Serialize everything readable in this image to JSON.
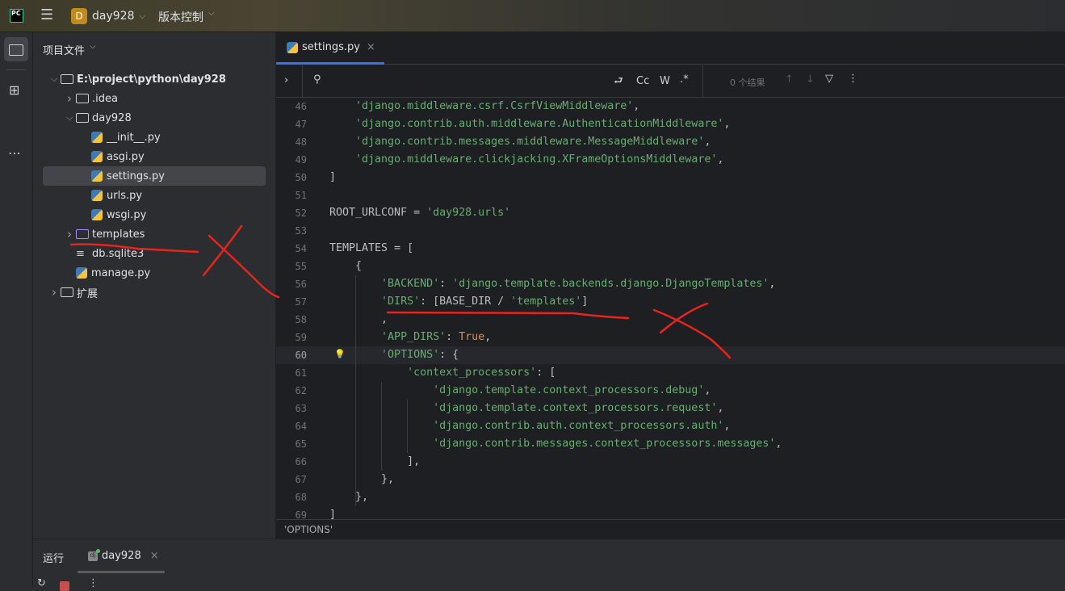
{
  "topbar": {
    "app_logo": "PC",
    "menu_icon": "hamburger-icon",
    "project_badge": "D",
    "project_name": "day928",
    "vcs_label": "版本控制",
    "accent": "#c08a1e"
  },
  "project_panel": {
    "title": "项目文件",
    "items": [
      {
        "label": "E:\\project\\python\\day928",
        "type": "folder",
        "expanded": true
      },
      {
        "label": ".idea",
        "type": "folder",
        "expanded": false
      },
      {
        "label": "day928",
        "type": "package",
        "expanded": true
      },
      {
        "label": "__init__.py",
        "type": "python"
      },
      {
        "label": "asgi.py",
        "type": "python"
      },
      {
        "label": "settings.py",
        "type": "python",
        "selected": true
      },
      {
        "label": "urls.py",
        "type": "python"
      },
      {
        "label": "wsgi.py",
        "type": "python"
      },
      {
        "label": "templates",
        "type": "template-folder",
        "expanded": false
      },
      {
        "label": "db.sqlite3",
        "type": "text"
      },
      {
        "label": "manage.py",
        "type": "python"
      },
      {
        "label": "扩展",
        "type": "folder",
        "expanded": false
      }
    ]
  },
  "editor": {
    "tab": {
      "label": "settings.py",
      "accent": "#3574f0"
    },
    "search": {
      "match_case": "Cc",
      "words": "W",
      "regex": ".*",
      "results": "0 个结果"
    },
    "lines": [
      {
        "n": 46,
        "text": "    'django.middleware.csrf.CsrfViewMiddleware',"
      },
      {
        "n": 47,
        "text": "    'django.contrib.auth.middleware.AuthenticationMiddleware',"
      },
      {
        "n": 48,
        "text": "    'django.contrib.messages.middleware.MessageMiddleware',"
      },
      {
        "n": 49,
        "text": "    'django.middleware.clickjacking.XFrameOptionsMiddleware',"
      },
      {
        "n": 50,
        "text": "]"
      },
      {
        "n": 51,
        "text": ""
      },
      {
        "n": 52,
        "text": "ROOT_URLCONF = 'day928.urls'"
      },
      {
        "n": 53,
        "text": ""
      },
      {
        "n": 54,
        "text": "TEMPLATES = ["
      },
      {
        "n": 55,
        "text": "    {"
      },
      {
        "n": 56,
        "text": "        'BACKEND': 'django.template.backends.django.DjangoTemplates',"
      },
      {
        "n": 57,
        "text": "        'DIRS': [BASE_DIR / 'templates']"
      },
      {
        "n": 58,
        "text": "        ,"
      },
      {
        "n": 59,
        "text": "        'APP_DIRS': True,"
      },
      {
        "n": 60,
        "text": "        'OPTIONS': {",
        "current": true
      },
      {
        "n": 61,
        "text": "            'context_processors': ["
      },
      {
        "n": 62,
        "text": "                'django.template.context_processors.debug',"
      },
      {
        "n": 63,
        "text": "                'django.template.context_processors.request',"
      },
      {
        "n": 64,
        "text": "                'django.contrib.auth.context_processors.auth',"
      },
      {
        "n": 65,
        "text": "                'django.contrib.messages.context_processors.messages',"
      },
      {
        "n": 66,
        "text": "            ],"
      },
      {
        "n": 67,
        "text": "        },"
      },
      {
        "n": 68,
        "text": "    },"
      },
      {
        "n": 69,
        "text": "]"
      }
    ],
    "breadcrumb": "'OPTIONS'",
    "colors": {
      "string": "#6aab73",
      "keyword": "#cf8e6d",
      "text": "#bcbec4"
    }
  },
  "bottom_panel": {
    "title": "运行",
    "run_tab": "day928"
  },
  "annotations": {
    "color": "#e8241c"
  }
}
